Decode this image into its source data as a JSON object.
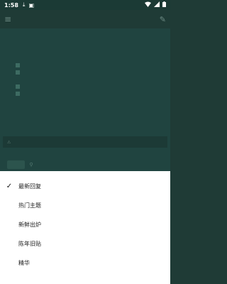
{
  "status_bar": {
    "time": "1:58",
    "icons": [
      "download-icon",
      "notification-icon",
      "wifi-icon",
      "signal-icon",
      "battery-icon"
    ]
  },
  "app_bar": {
    "title": "",
    "menu_icon": "hamburger-icon",
    "action_icon": "edit-icon"
  },
  "sort_sheet": {
    "selected_index": 0,
    "options": [
      "最新回复",
      "热门主题",
      "新鲜出炉",
      "陈年旧贴",
      "精华"
    ]
  },
  "colors": {
    "scrim": "#1f3b36",
    "sheet_bg": "#ffffff",
    "text": "#222222"
  }
}
